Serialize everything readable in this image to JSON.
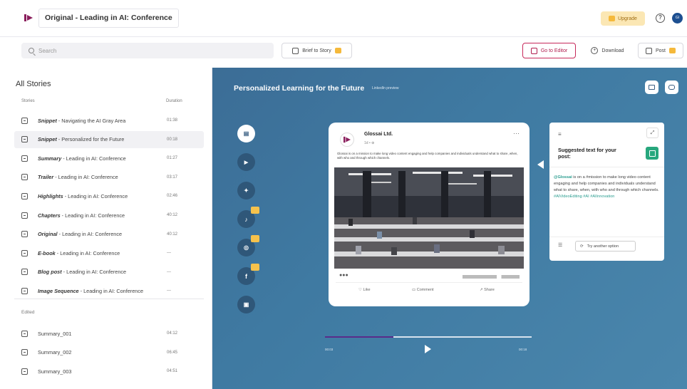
{
  "header": {
    "doc_title": "Original - Leading in AI: Conference",
    "upgrade_label": "Upgrade",
    "help_glyph": "?",
    "avatar_initials": "GI"
  },
  "toolbar": {
    "search_placeholder": "Search",
    "brief_to_story_label": "Brief to Story",
    "go_to_editor_label": "Go to Editor",
    "download_label": "Download",
    "post_label": "Post"
  },
  "sidebar": {
    "title": "All Stories",
    "col_stories": "Stories",
    "col_duration": "Duration",
    "stories": [
      {
        "kind": "Snippet",
        "rest": " - Navigating the AI Gray Area",
        "duration": "01:38",
        "icon": "video-icon"
      },
      {
        "kind": "Snippet",
        "rest": " - Personalized  for the Future",
        "duration": "00:18",
        "icon": "video-icon",
        "active": true
      },
      {
        "kind": "Summary",
        "rest": " - Leading in AI: Conference",
        "duration": "01:27",
        "icon": "video-icon"
      },
      {
        "kind": "Trailer",
        "rest": " - Leading in AI: Conference",
        "duration": "03:17",
        "icon": "video-icon"
      },
      {
        "kind": "Highlights",
        "rest": " - Leading in AI: Conference",
        "duration": "02:46",
        "icon": "video-icon"
      },
      {
        "kind": "Chapters",
        "rest": " - Leading in AI: Conference",
        "duration": "40:12",
        "icon": "video-icon"
      },
      {
        "kind": "Original",
        "rest": " - Leading in AI: Conference",
        "duration": "40:12",
        "icon": "video-icon"
      },
      {
        "kind": "E-book",
        "rest": " - Leading in AI: Conference",
        "duration": "---",
        "icon": "book-icon"
      },
      {
        "kind": "Blog post",
        "rest": " - Leading in AI: Conference",
        "duration": "---",
        "icon": "document-icon"
      },
      {
        "kind": "Image Sequence",
        "rest": " - Leading in AI: Conference",
        "duration": "---",
        "icon": "images-icon"
      }
    ],
    "edited_label": "Edited",
    "edited": [
      {
        "label": "Summary_001",
        "duration": "04:12"
      },
      {
        "label": "Summary_002",
        "duration": "06:45"
      },
      {
        "label": "Summary_003",
        "duration": "04:51"
      }
    ]
  },
  "preview": {
    "title": "Personalized Learning for the Future",
    "subtitle": "LinkedIn preview",
    "social_icons": [
      "linkedin-icon",
      "youtube-icon",
      "twitter-icon",
      "tiktok-icon",
      "instagram-icon",
      "facebook-icon",
      "calendar-icon"
    ],
    "post": {
      "company": "Glossai Ltd.",
      "meta": "1d • ⊕",
      "text": "Glossai is on a mission to make long video content engaging and help companies and individuals understand what to share, when, with who and through which channels.",
      "like": "Like",
      "comment": "Comment",
      "share": "Share"
    },
    "suggestion": {
      "title": "Suggested text for your post:",
      "mention": "@Glossai",
      "body": " is on a #mission to make long video content engaging and help companies and individuals understand what to share, when, with who and through which channels.",
      "hashtags": "#AIVideoEditing #AI #AIInnovation",
      "try_another": "Try another option"
    },
    "player": {
      "time_current": "00:03",
      "time_total": "00:18",
      "progress_fraction": 0.33
    }
  },
  "colors": {
    "brand": "#8a1e5c",
    "preview_bg": "#3f7aa2",
    "accent_green": "#27a77d",
    "premium_yellow": "#f5c24c"
  }
}
